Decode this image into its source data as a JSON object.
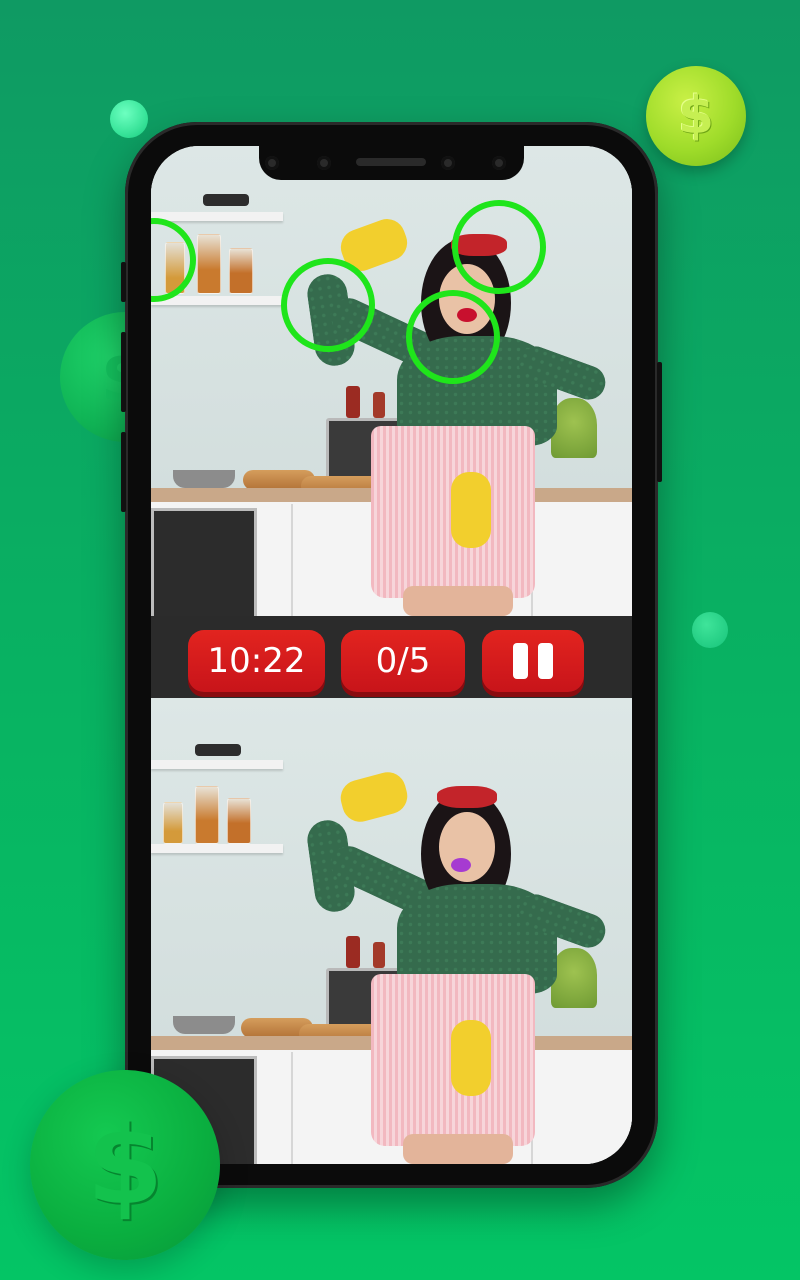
{
  "hud": {
    "timer": "10:22",
    "found_count": "0/5",
    "pause_icon": "pause-icon"
  },
  "decor": {
    "coin_symbol": "$",
    "marker_color": "#1fe51b",
    "pill_color": "#d31a1d"
  }
}
